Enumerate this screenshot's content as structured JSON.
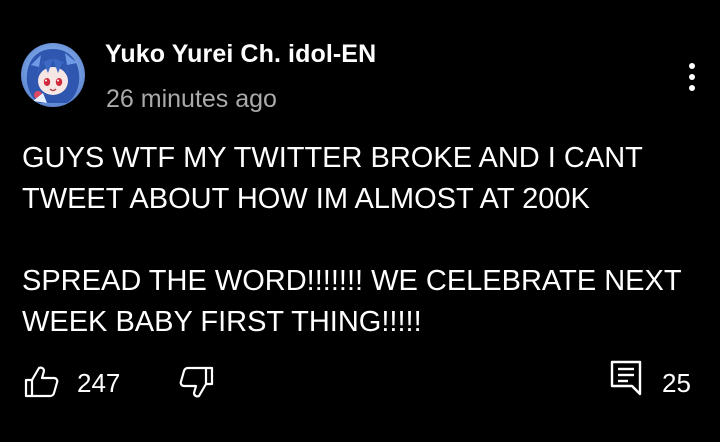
{
  "comment": {
    "author": "Yuko Yurei Ch. idol-EN",
    "timestamp": "26 minutes ago",
    "text": "GUYS WTF MY TWITTER BROKE AND I CANT\nTWEET ABOUT HOW IM ALMOST AT 200K\n\nSPREAD THE WORD!!!!!!! WE CELEBRATE NEXT\nWEEK BABY FIRST THING!!!!!"
  },
  "actions": {
    "like_count": "247",
    "reply_count": "25"
  },
  "icons": {
    "avatar": "avatar-image",
    "more": "more-vert-icon",
    "like": "thumb-up-icon",
    "dislike": "thumb-down-icon",
    "reply": "reply-comment-icon"
  },
  "colors": {
    "background": "#000000",
    "text": "#ffffff",
    "secondary_text": "#aaaaaa"
  }
}
